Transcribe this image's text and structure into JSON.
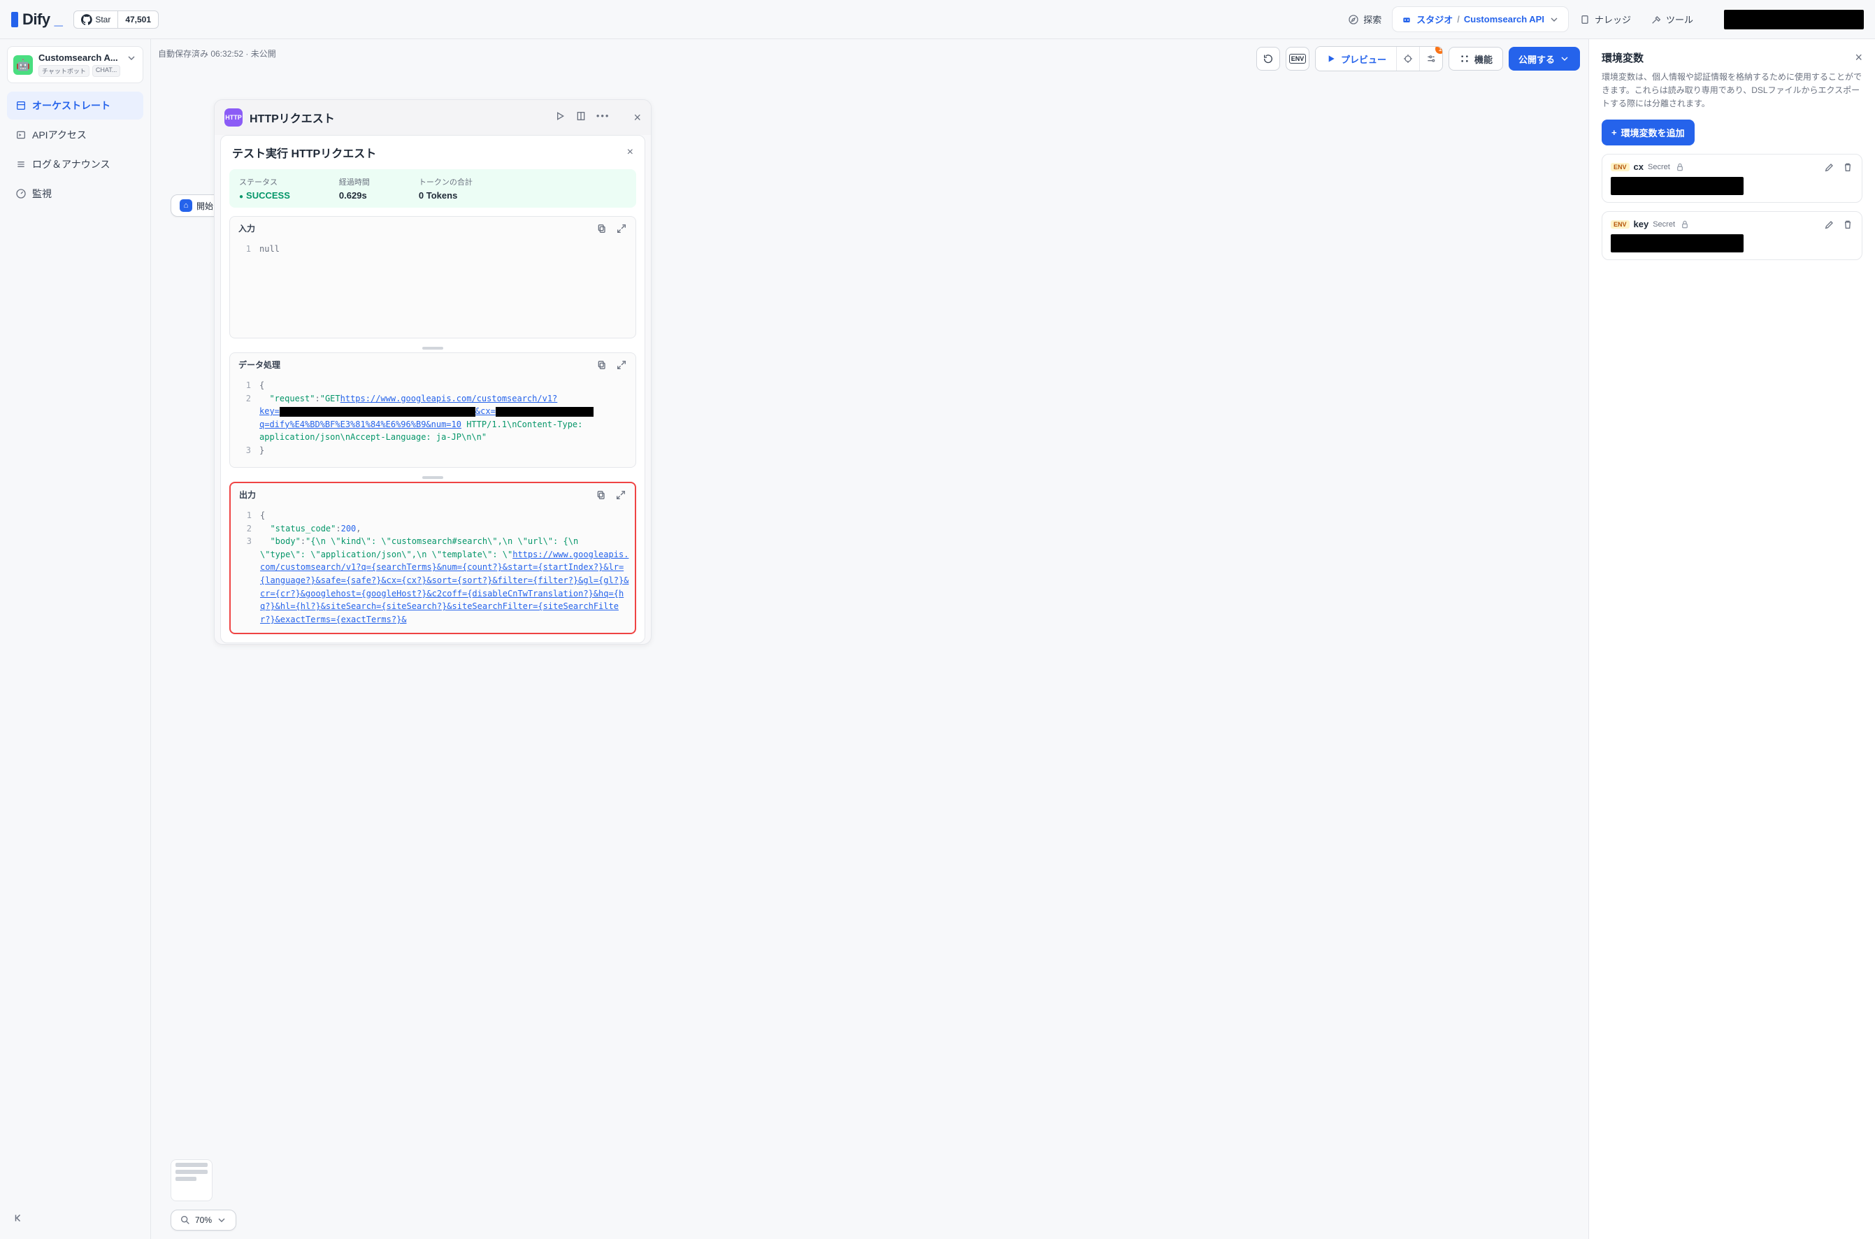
{
  "topnav": {
    "logo": "Dify",
    "star_label": "Star",
    "star_count": "47,501",
    "explore": "探索",
    "studio": "スタジオ",
    "breadcrumb": "Customsearch API",
    "knowledge": "ナレッジ",
    "tools": "ツール"
  },
  "app": {
    "name": "Customsearch A...",
    "tag1": "チャットボット",
    "tag2": "CHAT..."
  },
  "sidebar": {
    "orchestrate": "オーケストレート",
    "api_access": "APIアクセス",
    "logs": "ログ＆アナウンス",
    "monitor": "監視"
  },
  "canvas": {
    "autosave": "自動保存済み 06:32:52 · 未公開",
    "preview": "プレビュー",
    "features": "機能",
    "publish": "公開する",
    "start_node": "開始",
    "zoom": "70%"
  },
  "http": {
    "badge": "HTTP",
    "title": "HTTPリクエスト",
    "test_title": "テスト実行 HTTPリクエスト",
    "status_label": "ステータス",
    "status_value": "SUCCESS",
    "elapsed_label": "経過時間",
    "elapsed_value": "0.629s",
    "tokens_label": "トークンの合計",
    "tokens_value": "0 Tokens",
    "input_label": "入力",
    "input_line": "null",
    "data_label": "データ処理",
    "output_label": "出力",
    "req": {
      "key": "\"request\"",
      "method": "\"GET ",
      "url1": "https://www.googleapis.com/customsearch/v1?",
      "key_part": "key=",
      "cx_part": "&cx=",
      "tail": "q=dify%E4%BD%BF%E3%81%84%E6%96%B9&num=10",
      "http": " HTTP/1.1\\nContent-Type: ",
      "ct": "application/json\\nAccept-Language: ja-JP\\n\\n\""
    },
    "out": {
      "sc_key": "\"status_code\"",
      "sc_val": "200",
      "body_key": "\"body\"",
      "body_a": "\"{\\n  \\\"kind\\\": \\\"customsearch#search\\\",\\n  \\\"url\\\": {\\n  ",
      "body_b": "\\\"type\\\": \\\"application/json\\\",\\n    \\\"template\\\": \\\"",
      "url": "https://www.googleapis.com/customsearch/v1?q={searchTerms}&num={count?}&start={startIndex?}&lr={language?}&safe={safe?}&cx={cx?}&sort={sort?}&filter={filter?}&gl={gl?}&cr={cr?}&googlehost={googleHost?}&c2coff={disableCnTwTranslation?}&hq={hq?}&hl={hl?}&siteSearch={siteSearch?}&siteSearchFilter={siteSearchFilter?}&exactTerms={exactTerms?}&"
    }
  },
  "env": {
    "title": "環境変数",
    "desc": "環境変数は、個人情報や認証情報を格納するために使用することができます。これらは読み取り専用であり、DSLファイルからエクスポートする際には分離されます。",
    "add": "環境変数を追加",
    "secret": "Secret",
    "vars": [
      {
        "tag": "ENV",
        "name": "cx"
      },
      {
        "tag": "ENV",
        "name": "key"
      }
    ]
  }
}
